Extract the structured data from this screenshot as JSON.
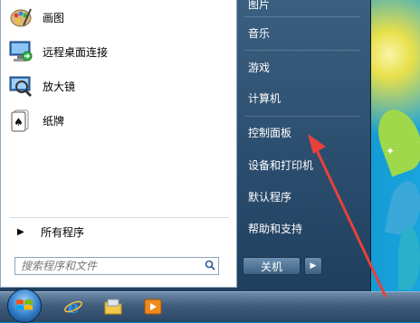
{
  "start_menu": {
    "programs": [
      {
        "label": "画图",
        "icon": "paint-icon"
      },
      {
        "label": "远程桌面连接",
        "icon": "remote-desktop-icon"
      },
      {
        "label": "放大镜",
        "icon": "magnifier-icon"
      },
      {
        "label": "纸牌",
        "icon": "solitaire-icon"
      }
    ],
    "all_programs_label": "所有程序",
    "search_placeholder": "搜索程序和文件",
    "right_items": [
      "图片",
      "音乐",
      "游戏",
      "计算机",
      "控制面板",
      "设备和打印机",
      "默认程序",
      "帮助和支持"
    ],
    "shutdown_label": "关机"
  },
  "taskbar": {
    "apps": [
      "internet-explorer-icon",
      "file-explorer-icon",
      "media-player-icon"
    ]
  },
  "colors": {
    "annotation": "#e8413c",
    "menu_dark": "#1f3f5e",
    "accent": "#2f7cc7"
  }
}
